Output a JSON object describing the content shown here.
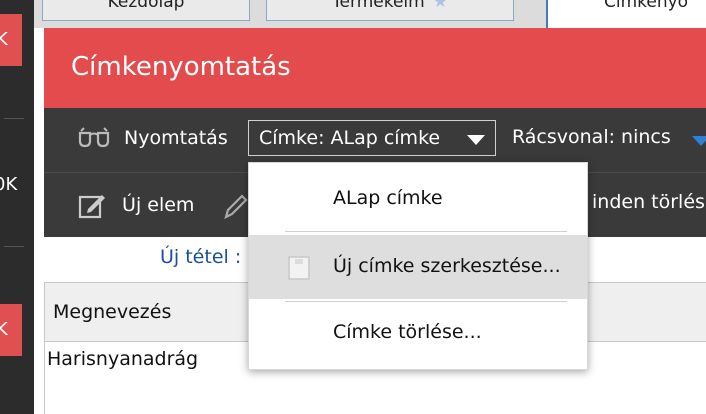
{
  "sidebar": {
    "item1": "K",
    "item2": "0K",
    "item3": "K"
  },
  "tabs": [
    {
      "label": "Kezdőlap"
    },
    {
      "label": "Termékeim"
    },
    {
      "label": "Címkenyo"
    }
  ],
  "header": {
    "title": "Címkenyomtatás"
  },
  "toolbar1": {
    "print_label": "Nyomtatás",
    "label_select": "Címke: ALap címke",
    "grid_label": "Rácsvonal: nincs"
  },
  "toolbar2": {
    "new_item": "Új elem",
    "delete_all": "inden törlés"
  },
  "new_entry_label": "Új tétel :",
  "table": {
    "header": "Megnevezés",
    "rows": [
      "Harisnyanadrág"
    ]
  },
  "dropdown": {
    "items": [
      {
        "label": "ALap címke"
      },
      {
        "label": "Új címke szerkesztése..."
      },
      {
        "label": "Címke törlése..."
      }
    ]
  },
  "colors": {
    "accent_red": "#e34b4c",
    "toolbar_bg": "#3a3a3a",
    "link_blue": "#1a4f9c"
  }
}
